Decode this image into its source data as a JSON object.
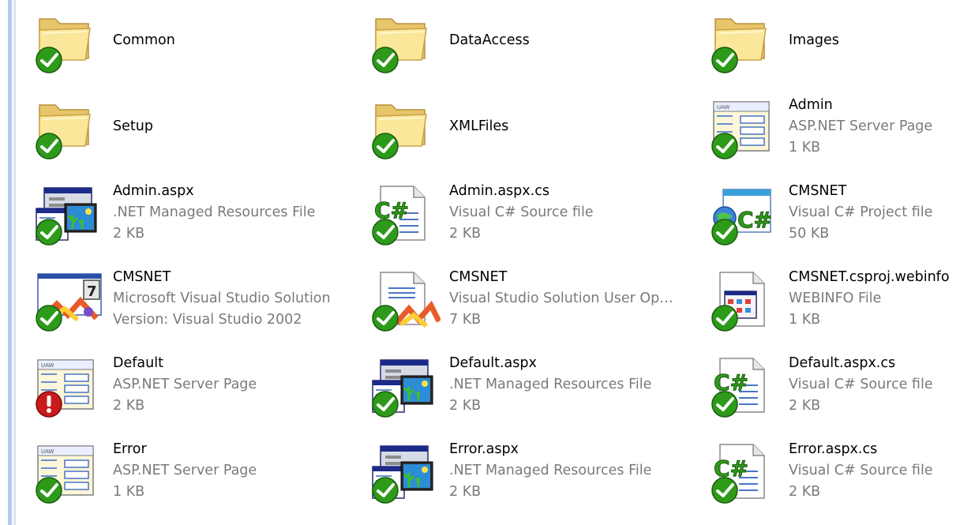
{
  "items": [
    {
      "name": "Common",
      "line2": "",
      "line3": "",
      "icon": "folder-icon",
      "overlay": "ok"
    },
    {
      "name": "DataAccess",
      "line2": "",
      "line3": "",
      "icon": "folder-icon",
      "overlay": "ok"
    },
    {
      "name": "Images",
      "line2": "",
      "line3": "",
      "icon": "folder-icon",
      "overlay": "ok"
    },
    {
      "name": "Setup",
      "line2": "",
      "line3": "",
      "icon": "folder-icon",
      "overlay": "ok"
    },
    {
      "name": "XMLFiles",
      "line2": "",
      "line3": "",
      "icon": "folder-icon",
      "overlay": "ok"
    },
    {
      "name": "Admin",
      "line2": "ASP.NET Server Page",
      "line3": "1 KB",
      "icon": "aspx-page-icon",
      "overlay": "ok"
    },
    {
      "name": "Admin.aspx",
      "line2": ".NET Managed Resources File",
      "line3": "2 KB",
      "icon": "resx-icon",
      "overlay": "ok"
    },
    {
      "name": "Admin.aspx.cs",
      "line2": "Visual C# Source file",
      "line3": "2 KB",
      "icon": "csharp-file-icon",
      "overlay": "ok"
    },
    {
      "name": "CMSNET",
      "line2": "Visual C# Project file",
      "line3": "50 KB",
      "icon": "csharp-project-icon",
      "overlay": "ok"
    },
    {
      "name": "CMSNET",
      "line2": "Microsoft Visual Studio Solution",
      "line3": "Version: Visual Studio 2002",
      "icon": "vs-solution-icon",
      "overlay": "ok"
    },
    {
      "name": "CMSNET",
      "line2": "Visual Studio Solution User Op…",
      "line3": "7 KB",
      "icon": "vs-user-options-icon",
      "overlay": "ok"
    },
    {
      "name": "CMSNET.csproj.webinfo",
      "line2": "WEBINFO File",
      "line3": "1 KB",
      "icon": "webinfo-file-icon",
      "overlay": "ok"
    },
    {
      "name": "Default",
      "line2": "ASP.NET Server Page",
      "line3": "2 KB",
      "icon": "aspx-page-icon",
      "overlay": "modified"
    },
    {
      "name": "Default.aspx",
      "line2": ".NET Managed Resources File",
      "line3": "2 KB",
      "icon": "resx-icon",
      "overlay": "ok"
    },
    {
      "name": "Default.aspx.cs",
      "line2": "Visual C# Source file",
      "line3": "2 KB",
      "icon": "csharp-file-icon",
      "overlay": "ok"
    },
    {
      "name": "Error",
      "line2": "ASP.NET Server Page",
      "line3": "1 KB",
      "icon": "aspx-page-icon",
      "overlay": "ok"
    },
    {
      "name": "Error.aspx",
      "line2": ".NET Managed Resources File",
      "line3": "2 KB",
      "icon": "resx-icon",
      "overlay": "ok"
    },
    {
      "name": "Error.aspx.cs",
      "line2": "Visual C# Source file",
      "line3": "2 KB",
      "icon": "csharp-file-icon",
      "overlay": "ok"
    }
  ],
  "colors": {
    "ok_overlay": "#2e9a1a",
    "modified_overlay": "#c81b1b",
    "subtext": "#7a7a7a",
    "rail": "#b4c9f0"
  }
}
